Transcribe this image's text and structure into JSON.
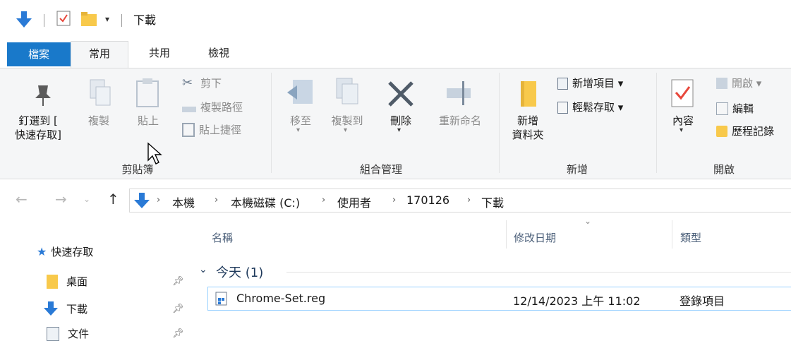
{
  "window": {
    "title": "下載"
  },
  "quick_access_toolbar": {
    "dropdown_glyph": "▾"
  },
  "tabs": [
    {
      "label": "檔案"
    },
    {
      "label": "常用"
    },
    {
      "label": "共用"
    },
    {
      "label": "檢視"
    }
  ],
  "ribbon": {
    "clipboard": {
      "group_label": "剪貼簿",
      "pin_label_1": "釘選到 [",
      "pin_label_2": "快速存取]",
      "copy_label": "複製",
      "paste_label": "貼上",
      "cut_label": "剪下",
      "copy_path_label": "複製路徑",
      "paste_shortcut_label": "貼上捷徑"
    },
    "organize": {
      "group_label": "組合管理",
      "move_to_label": "移至",
      "copy_to_label": "複製到",
      "delete_label": "刪除",
      "rename_label": "重新命名"
    },
    "new": {
      "group_label": "新增",
      "new_folder_label_1": "新增",
      "new_folder_label_2": "資料夾",
      "new_item_label": "新增項目 ▾",
      "easy_access_label": "輕鬆存取 ▾"
    },
    "open": {
      "group_label": "開啟",
      "properties_label": "內容",
      "open_label": "開啟 ▾",
      "edit_label": "編輯",
      "history_label": "歷程記錄"
    }
  },
  "address": {
    "crumbs": [
      "本機",
      "本機磁碟 (C:)",
      "使用者",
      "170126",
      "下載"
    ],
    "separator": "›"
  },
  "nav_pane": {
    "quick_access_label": "快速存取",
    "items": [
      {
        "label": "桌面",
        "pinned": true
      },
      {
        "label": "下載",
        "pinned": true
      },
      {
        "label": "文件",
        "pinned": true
      }
    ]
  },
  "content": {
    "columns": {
      "name": "名稱",
      "modified": "修改日期",
      "type": "類型"
    },
    "group_header": "今天 (1)",
    "files": [
      {
        "name": "Chrome-Set.reg",
        "modified": "12/14/2023 上午 11:02",
        "type": "登錄項目"
      }
    ]
  },
  "colors": {
    "accent": "#1979ca",
    "ribbon_bg": "#f5f6f7",
    "selection_border": "#99d1ff",
    "folder_yellow": "#f8c94b"
  }
}
